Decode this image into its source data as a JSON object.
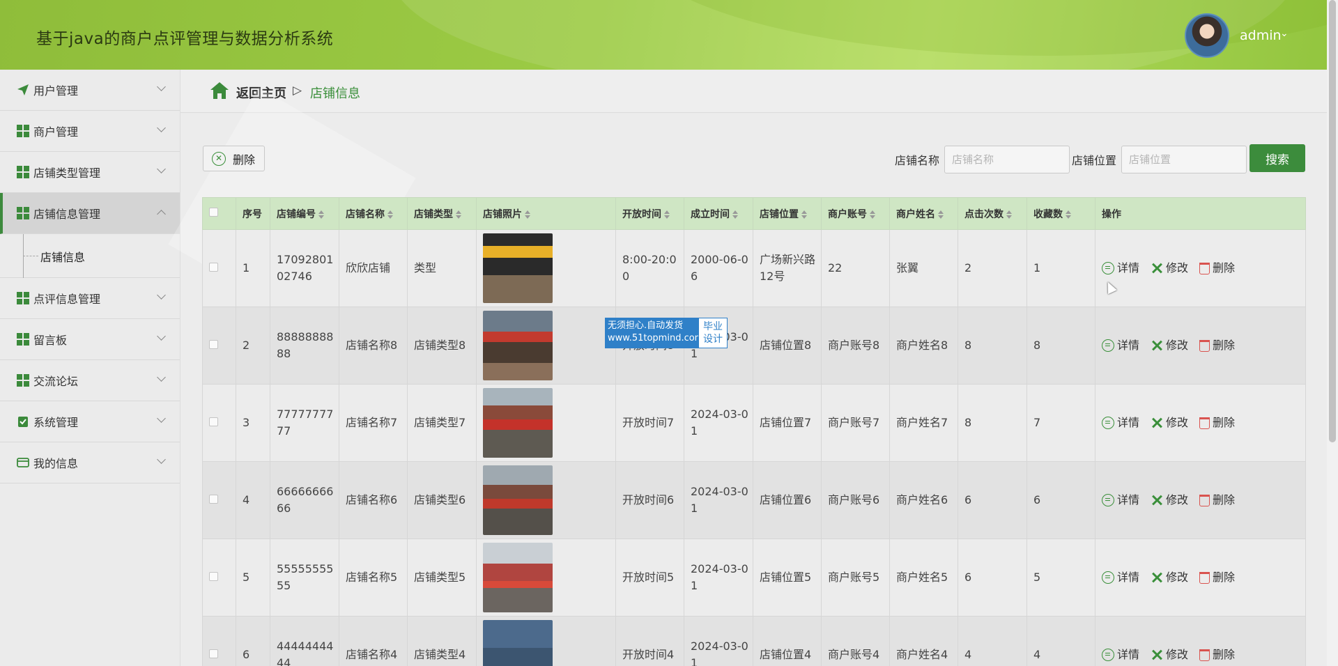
{
  "app": {
    "title": "基于java的商户点评管理与数据分析系统",
    "user": "admin",
    "accent_color": "#3c8c3c",
    "header_color": "#9ccb45"
  },
  "sidebar": {
    "items": [
      {
        "label": "用户管理",
        "icon": "paper-plane-icon"
      },
      {
        "label": "商户管理",
        "icon": "grid-icon"
      },
      {
        "label": "店铺类型管理",
        "icon": "grid-icon"
      },
      {
        "label": "店铺信息管理",
        "icon": "grid-icon",
        "active": true,
        "sub": "店铺信息"
      },
      {
        "label": "点评信息管理",
        "icon": "grid-icon"
      },
      {
        "label": "留言板",
        "icon": "grid-icon"
      },
      {
        "label": "交流论坛",
        "icon": "grid-icon"
      },
      {
        "label": "系统管理",
        "icon": "clipboard-check-icon"
      },
      {
        "label": "我的信息",
        "icon": "wallet-card-icon"
      }
    ]
  },
  "breadcrumb": {
    "home": "返回主页",
    "separator": "▷",
    "current": "店铺信息"
  },
  "toolbar": {
    "delete_label": "删除",
    "name_label": "店铺名称",
    "name_placeholder": "店铺名称",
    "location_label": "店铺位置",
    "location_placeholder": "店铺位置",
    "search_label": "搜索"
  },
  "table": {
    "headers": [
      "序号",
      "店铺编号",
      "店铺名称",
      "店铺类型",
      "店铺照片",
      "开放时间",
      "成立时间",
      "店铺位置",
      "商户账号",
      "商户姓名",
      "点击次数",
      "收藏数",
      "操作"
    ],
    "rows": [
      {
        "no": "1",
        "code": "1709280102746",
        "name": "欣欣店铺",
        "type": "类型",
        "hours": "8:00-20:00",
        "founded": "2000-06-06",
        "location": "广场新兴路12号",
        "account": "22",
        "owner": "张翼",
        "clicks": "2",
        "favs": "1"
      },
      {
        "no": "2",
        "code": "8888888888",
        "name": "店铺名称8",
        "type": "店铺类型8",
        "hours": "开放时间8",
        "founded": "2024-03-01",
        "location": "店铺位置8",
        "account": "商户账号8",
        "owner": "商户姓名8",
        "clicks": "8",
        "favs": "8"
      },
      {
        "no": "3",
        "code": "7777777777",
        "name": "店铺名称7",
        "type": "店铺类型7",
        "hours": "开放时间7",
        "founded": "2024-03-01",
        "location": "店铺位置7",
        "account": "商户账号7",
        "owner": "商户姓名7",
        "clicks": "8",
        "favs": "7"
      },
      {
        "no": "4",
        "code": "6666666666",
        "name": "店铺名称6",
        "type": "店铺类型6",
        "hours": "开放时间6",
        "founded": "2024-03-01",
        "location": "店铺位置6",
        "account": "商户账号6",
        "owner": "商户姓名6",
        "clicks": "6",
        "favs": "6"
      },
      {
        "no": "5",
        "code": "5555555555",
        "name": "店铺名称5",
        "type": "店铺类型5",
        "hours": "开放时间5",
        "founded": "2024-03-01",
        "location": "店铺位置5",
        "account": "商户账号5",
        "owner": "商户姓名5",
        "clicks": "6",
        "favs": "5"
      },
      {
        "no": "6",
        "code": "4444444444",
        "name": "店铺名称4",
        "type": "店铺类型4",
        "hours": "开放时间4",
        "founded": "2024-03-01",
        "location": "店铺位置4",
        "account": "商户账号4",
        "owner": "商户姓名4",
        "clicks": "4",
        "favs": "4"
      }
    ],
    "actions": {
      "detail": "详情",
      "edit": "修改",
      "delete": "删除"
    }
  },
  "watermark": {
    "line1": "无须担心.自动发货",
    "line2": "www.51topmind.com",
    "right1": "毕业",
    "right2": "设计"
  }
}
